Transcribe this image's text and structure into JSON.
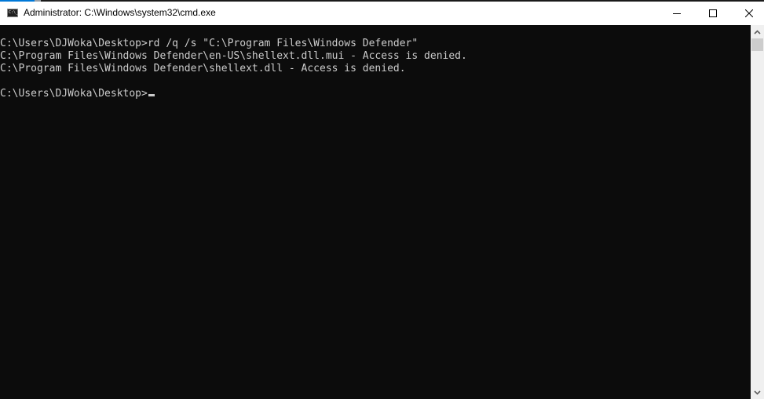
{
  "window": {
    "title": "Administrator: C:\\Windows\\system32\\cmd.exe",
    "app_icon_label": "C:\\_",
    "controls": {
      "minimize": "minimize-icon",
      "maximize": "maximize-icon",
      "close": "close-icon"
    }
  },
  "console": {
    "lines": [
      "C:\\Users\\DJWoka\\Desktop>rd /q /s \"C:\\Program Files\\Windows Defender\"",
      "C:\\Program Files\\Windows Defender\\en-US\\shellext.dll.mui - Access is denied.",
      "C:\\Program Files\\Windows Defender\\shellext.dll - Access is denied.",
      "",
      "C:\\Users\\DJWoka\\Desktop>"
    ]
  },
  "scrollbar": {
    "up": "chevron-up-icon",
    "down": "chevron-down-icon"
  }
}
